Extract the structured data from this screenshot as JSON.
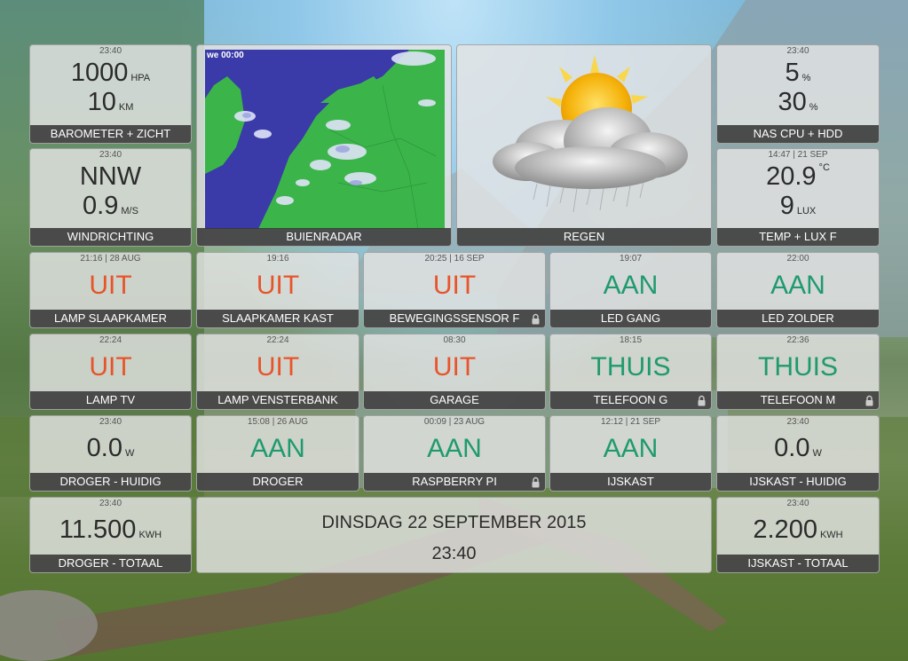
{
  "colors": {
    "off": "#e8542a",
    "on": "#1f9a6e",
    "bar": "#373737"
  },
  "tiles": {
    "barometer": {
      "time": "23:40",
      "value1": "1000",
      "unit1": "HPA",
      "value2": "10",
      "unit2": "KM",
      "label": "BAROMETER + ZICHT"
    },
    "radar": {
      "overlay": "we 00:00",
      "label": "BUIENRADAR"
    },
    "weather": {
      "icon": "partly-cloudy-rain-icon",
      "label": "REGEN"
    },
    "nas": {
      "time": "23:40",
      "value1": "5",
      "unit1": "%",
      "value2": "30",
      "unit2": "%",
      "label": "NAS CPU + HDD"
    },
    "wind": {
      "time": "23:40",
      "value1": "NNW",
      "value2": "0.9",
      "unit2": "M/S",
      "label": "WINDRICHTING"
    },
    "temp": {
      "time": "14:47 | 21 SEP",
      "value1": "20.9",
      "unit1": "°C",
      "value2": "9",
      "unit2": "LUX",
      "label": "TEMP + LUX F"
    },
    "lamp_slaapkamer": {
      "time": "21:16 | 28 AUG",
      "state": "UIT",
      "label": "LAMP SLAAPKAMER"
    },
    "slaapkamer_kast": {
      "time": "19:16",
      "state": "UIT",
      "label": "SLAAPKAMER KAST"
    },
    "bewegingssensor": {
      "time": "20:25 | 16 SEP",
      "state": "UIT",
      "label": "BEWEGINGSSENSOR F"
    },
    "led_gang": {
      "time": "19:07",
      "state": "AAN",
      "label": "LED GANG"
    },
    "led_zolder": {
      "time": "22:00",
      "state": "AAN",
      "label": "LED ZOLDER"
    },
    "lamp_tv": {
      "time": "22:24",
      "state": "UIT",
      "label": "LAMP TV"
    },
    "lamp_vensterbank": {
      "time": "22:24",
      "state": "UIT",
      "label": "LAMP VENSTERBANK"
    },
    "garage": {
      "time": "08:30",
      "state": "UIT",
      "label": "GARAGE"
    },
    "telefoon_g": {
      "time": "18:15",
      "state": "THUIS",
      "label": "TELEFOON G"
    },
    "telefoon_m": {
      "time": "22:36",
      "state": "THUIS",
      "label": "TELEFOON M"
    },
    "droger_huidig": {
      "time": "23:40",
      "value": "0.0",
      "unit": "W",
      "label": "DROGER - HUIDIG"
    },
    "droger": {
      "time": "15:08 | 26 AUG",
      "state": "AAN",
      "label": "DROGER"
    },
    "raspberry": {
      "time": "00:09 | 23 AUG",
      "state": "AAN",
      "label": "RASPBERRY PI"
    },
    "ijskast": {
      "time": "12:12 | 21 SEP",
      "state": "AAN",
      "label": "IJSKAST"
    },
    "ijskast_huidig": {
      "time": "23:40",
      "value": "0.0",
      "unit": "W",
      "label": "IJSKAST - HUIDIG"
    },
    "droger_totaal": {
      "time": "23:40",
      "value": "11.500",
      "unit": "KWH",
      "label": "DROGER - TOTAAL"
    },
    "clock": {
      "date": "DINSDAG 22 SEPTEMBER 2015",
      "time": "23:40"
    },
    "ijskast_totaal": {
      "time": "23:40",
      "value": "2.200",
      "unit": "KWH",
      "label": "IJSKAST - TOTAAL"
    }
  }
}
